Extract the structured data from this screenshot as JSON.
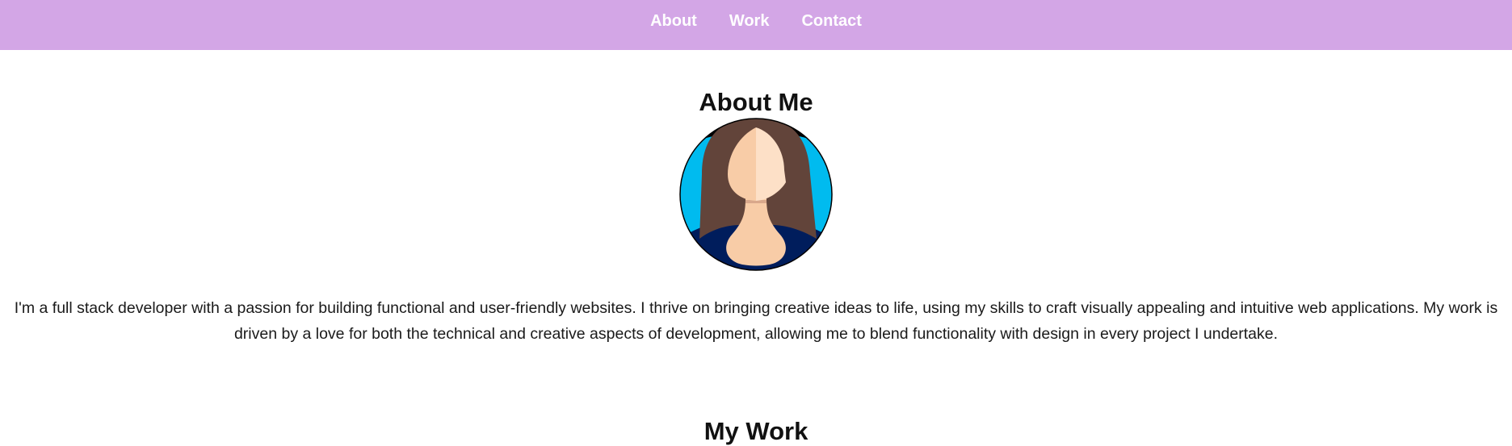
{
  "nav": {
    "items": [
      {
        "label": "About"
      },
      {
        "label": "Work"
      },
      {
        "label": "Contact"
      }
    ]
  },
  "about": {
    "title": "About Me",
    "avatar_icon": "woman-avatar-icon",
    "text": "I'm a full stack developer with a passion for building functional and user-friendly websites. I thrive on bringing creative ideas to life, using my skills to craft visually appealing and intuitive web applications. My work is driven by a love for both the technical and creative aspects of development, allowing me to blend functionality with design in every project I undertake."
  },
  "work": {
    "title": "My Work"
  },
  "colors": {
    "nav_background": "#d3a6e6",
    "nav_text": "#ffffff",
    "avatar_ring": "#000000",
    "avatar_background": "#00bbef",
    "hair": "#62443a",
    "skin": "#f8cca7",
    "shirt": "#001d5c"
  }
}
